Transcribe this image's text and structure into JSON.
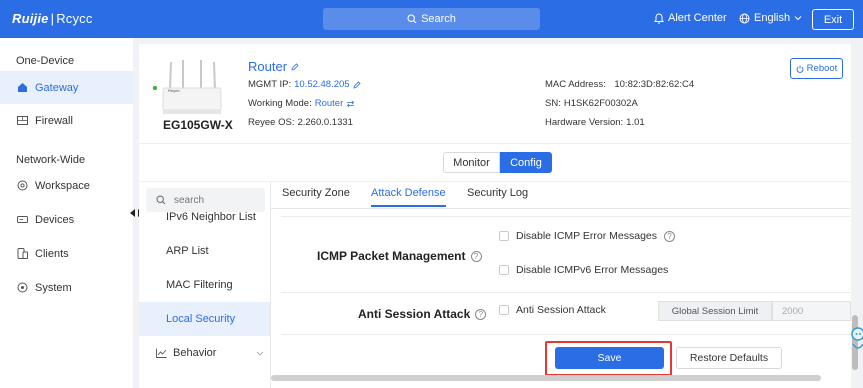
{
  "topbar": {
    "logo_main": "Ruijie",
    "logo_sep": "|",
    "logo_sub": "Rcycc",
    "search_label": "Search",
    "alert_center": "Alert Center",
    "language": "English",
    "exit": "Exit",
    "accent_color": "#2b6de5"
  },
  "sidebar": {
    "group1": "One-Device",
    "items1": [
      {
        "label": "Gateway",
        "icon": "home-icon",
        "active": true
      },
      {
        "label": "Firewall",
        "icon": "firewall-icon",
        "active": false
      }
    ],
    "group2": "Network-Wide",
    "items2": [
      {
        "label": "Workspace",
        "icon": "workspace-icon"
      },
      {
        "label": "Devices",
        "icon": "devices-icon"
      },
      {
        "label": "Clients",
        "icon": "clients-icon"
      },
      {
        "label": "System",
        "icon": "system-icon"
      }
    ]
  },
  "device": {
    "image_brand": "Reyee",
    "model": "EG105GW-X",
    "name": "Router",
    "mgmt_ip_label": "MGMT IP:",
    "mgmt_ip": "10.52.48.205",
    "working_mode_label": "Working Mode:",
    "working_mode": "Router",
    "os_label": "Reyee OS:",
    "os_version": "2.260.0.1331",
    "mac_label": "MAC Address:",
    "mac": "10:82:3D:82:62:C4",
    "sn_label": "SN:",
    "sn": "H1SK62F00302A",
    "hw_label": "Hardware Version:",
    "hw_version": "1.01",
    "reboot": "Reboot",
    "online": true
  },
  "view_switch": {
    "monitor": "Monitor",
    "config": "Config",
    "selected": "Config"
  },
  "submenu": {
    "search_placeholder": "search",
    "items": [
      "IPv6 Neighbor List",
      "ARP List",
      "MAC Filtering",
      "Local Security",
      "Behavior"
    ],
    "active": "Local Security"
  },
  "tabs": {
    "items": [
      "Security Zone",
      "Attack Defense",
      "Security Log"
    ],
    "active": "Attack Defense"
  },
  "icmp": {
    "title": "ICMP Packet Management",
    "opt1": "Disable ICMP Error Messages",
    "opt1_checked": false,
    "opt2": "Disable ICMPv6 Error Messages",
    "opt2_checked": false
  },
  "anti_session": {
    "title": "Anti Session Attack",
    "opt": "Anti Session Attack",
    "opt_checked": false,
    "limit_label": "Global Session Limit",
    "limit_placeholder": "2000"
  },
  "actions": {
    "save": "Save",
    "restore": "Restore Defaults",
    "highlight_color": "#e53935"
  }
}
